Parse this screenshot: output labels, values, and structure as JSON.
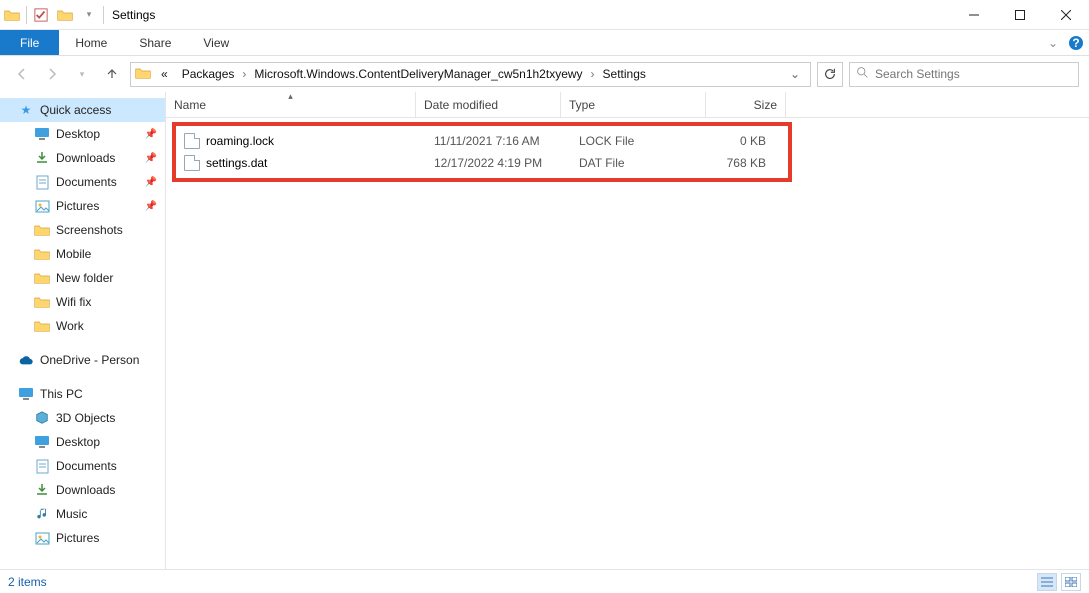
{
  "window": {
    "title": "Settings"
  },
  "ribbon": {
    "file": "File",
    "tabs": [
      "Home",
      "Share",
      "View"
    ]
  },
  "nav": {
    "crumb_prefix": "«",
    "breadcrumbs": [
      "Packages",
      "Microsoft.Windows.ContentDeliveryManager_cw5n1h2txyewy",
      "Settings"
    ],
    "search_placeholder": "Search Settings"
  },
  "sidebar": {
    "quick_access": "Quick access",
    "pinned": [
      {
        "label": "Desktop",
        "icon": "desktop"
      },
      {
        "label": "Downloads",
        "icon": "downloads"
      },
      {
        "label": "Documents",
        "icon": "documents"
      },
      {
        "label": "Pictures",
        "icon": "pictures"
      }
    ],
    "folders": [
      {
        "label": "Screenshots"
      },
      {
        "label": "Mobile"
      },
      {
        "label": "New folder"
      },
      {
        "label": "Wifi fix"
      },
      {
        "label": "Work"
      }
    ],
    "onedrive": "OneDrive - Person",
    "thispc": "This PC",
    "pc_children": [
      {
        "label": "3D Objects",
        "icon": "cube"
      },
      {
        "label": "Desktop",
        "icon": "desktop"
      },
      {
        "label": "Documents",
        "icon": "documents"
      },
      {
        "label": "Downloads",
        "icon": "downloads"
      },
      {
        "label": "Music",
        "icon": "music"
      },
      {
        "label": "Pictures",
        "icon": "pictures"
      }
    ]
  },
  "columns": {
    "name": "Name",
    "date": "Date modified",
    "type": "Type",
    "size": "Size"
  },
  "files": [
    {
      "name": "roaming.lock",
      "date": "11/11/2021 7:16 AM",
      "type": "LOCK File",
      "size": "0 KB"
    },
    {
      "name": "settings.dat",
      "date": "12/17/2022 4:19 PM",
      "type": "DAT File",
      "size": "768 KB"
    }
  ],
  "status": {
    "text": "2 items"
  }
}
